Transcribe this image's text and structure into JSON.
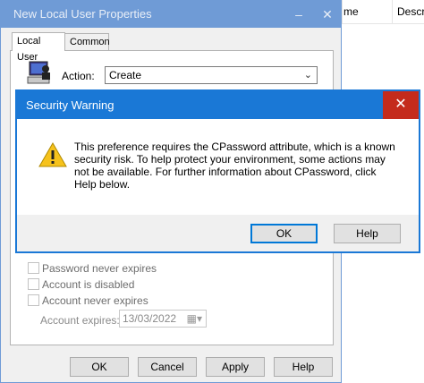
{
  "background_list": {
    "columns": [
      "me",
      "Descri"
    ]
  },
  "properties_window": {
    "title": "New Local User Properties",
    "min_glyph": "–",
    "close_glyph": "✕",
    "tabs": [
      {
        "label": "Local User",
        "active": true
      },
      {
        "label": "Common",
        "active": false
      }
    ],
    "action_label": "Action:",
    "action_value": "Create",
    "checkboxes": [
      {
        "label": "Password never expires",
        "checked": false
      },
      {
        "label": "Account is disabled",
        "checked": false
      },
      {
        "label": "Account never expires",
        "checked": false
      }
    ],
    "account_expires_label": "Account expires:",
    "account_expires_value": "13/03/2022",
    "buttons": {
      "ok": "OK",
      "cancel": "Cancel",
      "apply": "Apply",
      "help": "Help"
    }
  },
  "security_warning": {
    "title": "Security Warning",
    "close_glyph": "✕",
    "message": "This preference requires the CPassword attribute, which is a known security risk. To help protect your environment, some actions may not be available. For further information about CPassword, click Help below.",
    "buttons": {
      "ok": "OK",
      "help": "Help"
    }
  },
  "colors": {
    "inactive_title": "#6f9bd6",
    "active_title": "#1a78d6",
    "close_red": "#c42b1c",
    "warning_yellow": "#f6c21c"
  }
}
